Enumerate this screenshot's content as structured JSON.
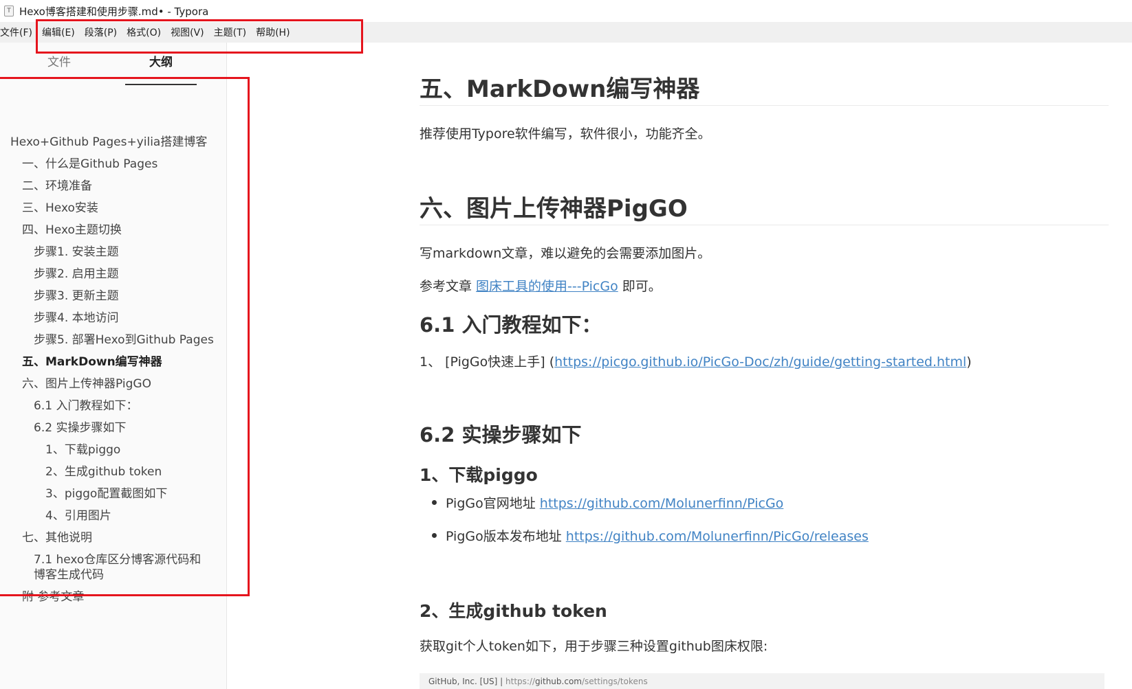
{
  "window": {
    "app_icon": "T",
    "title": "Hexo博客搭建和使用步骤.md• - Typora"
  },
  "menubar": {
    "items": [
      "文件(F)",
      "编辑(E)",
      "段落(P)",
      "格式(O)",
      "视图(V)",
      "主题(T)",
      "帮助(H)"
    ]
  },
  "sidebar": {
    "tabs": {
      "files": "文件",
      "outline": "大纲"
    },
    "outline": [
      {
        "label": "Hexo+Github Pages+yilia搭建博客",
        "level": 1
      },
      {
        "label": "一、什么是Github Pages",
        "level": 2
      },
      {
        "label": "二、环境准备",
        "level": 2
      },
      {
        "label": "三、Hexo安装",
        "level": 2
      },
      {
        "label": "四、Hexo主题切换",
        "level": 2
      },
      {
        "label": "步骤1. 安装主题",
        "level": 3
      },
      {
        "label": "步骤2. 启用主题",
        "level": 3
      },
      {
        "label": "步骤3. 更新主题",
        "level": 3
      },
      {
        "label": "步骤4. 本地访问",
        "level": 3
      },
      {
        "label": "步骤5. 部署Hexo到Github Pages",
        "level": 3
      },
      {
        "label": "五、MarkDown编写神器",
        "level": 2,
        "active": true
      },
      {
        "label": "六、图片上传神器PigGO",
        "level": 2
      },
      {
        "label": "6.1 入门教程如下：",
        "level": 3
      },
      {
        "label": "6.2 实操步骤如下",
        "level": 3
      },
      {
        "label": "1、下载piggo",
        "level": 4
      },
      {
        "label": "2、生成github token",
        "level": 4
      },
      {
        "label": "3、piggo配置截图如下",
        "level": 4
      },
      {
        "label": "4、引用图片",
        "level": 4
      },
      {
        "label": "七、其他说明",
        "level": 2
      },
      {
        "label": "7.1 hexo仓库区分博客源代码和",
        "level": 3
      },
      {
        "label": "博客生成代码",
        "level": 3
      },
      {
        "label": "附 参考文章",
        "level": 2
      }
    ]
  },
  "content": {
    "h_section5": "五、MarkDown编写神器",
    "p_section5": "推荐使用Typore软件编写，软件很小，功能齐全。",
    "h_section6": "六、图片上传神器PigGO",
    "p_section6": "写markdown文章，难以避免的会需要添加图片。",
    "ref_prefix": "参考文章 ",
    "ref_link": "图床工具的使用---PicGo",
    "ref_suffix": " 即可。",
    "h_6_1": "6.1 入门教程如下：",
    "p_6_1_prefix": "1、 [PigGo快速上手] (",
    "p_6_1_link": "https://picgo.github.io/PicGo-Doc/zh/guide/getting-started.html",
    "p_6_1_suffix": ")",
    "h_6_2": "6.2 实操步骤如下",
    "h_step1": "1、下载piggo",
    "li1_prefix": "PigGo官网地址 ",
    "li1_link": "https://github.com/Molunerfinn/PicGo",
    "li2_prefix": "PigGo版本发布地址 ",
    "li2_link": "https://github.com/Molunerfinn/PicGo/releases",
    "h_step2": "2、生成github token",
    "p_step2": "获取git个人token如下，用于步骤三种设置github图床权限:",
    "img_strip_left": "GitHub, Inc. [US]  |  ",
    "img_strip_url_a": "https://",
    "img_strip_url_b": "github.com",
    "img_strip_url_c": "/settings/tokens"
  },
  "colors": {
    "link": "#4183c4",
    "annotation": "#e5141d",
    "menubar_bg": "#f0f0f0",
    "sidebar_bg": "#fafafa"
  }
}
